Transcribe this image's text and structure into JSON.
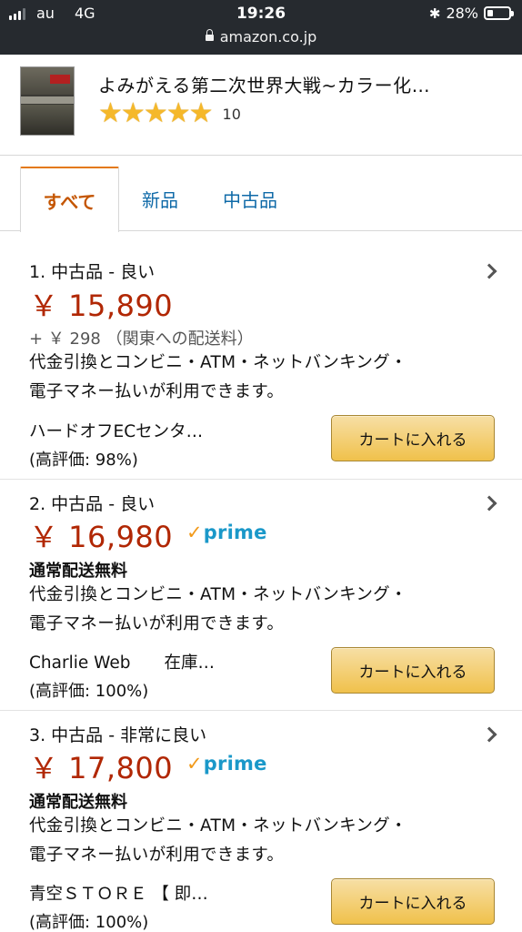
{
  "status_bar": {
    "carrier": "au",
    "network": "4G",
    "time": "19:26",
    "battery_percent": "28%",
    "battery_level": 0.28,
    "url": "amazon.co.jp"
  },
  "product": {
    "title": "よみがえる第二次世界大戦~カラー化…",
    "rating_stars": 5,
    "rating_count": "10"
  },
  "tabs": [
    {
      "label": "すべて",
      "selected": true
    },
    {
      "label": "新品",
      "selected": false
    },
    {
      "label": "中古品",
      "selected": false
    }
  ],
  "offers": [
    {
      "condition": "1. 中古品 - 良い",
      "price": "￥ 15,890",
      "prime": false,
      "shipping": "+ ￥ 298 （関東への配送料）",
      "payment_line1": "代金引換とコンビニ・ATM・ネットバンキング・",
      "payment_line2": "電子マネー払いが利用できます。",
      "seller": "ハードオフECセンタ…",
      "seller_rating": "(高評価: 98%)",
      "cart_button": "カートに入れる"
    },
    {
      "condition": "2. 中古品 - 良い",
      "price": "￥ 16,980",
      "prime": true,
      "prime_label": "prime",
      "shipping": "通常配送無料",
      "payment_line1": "代金引換とコンビニ・ATM・ネットバンキング・",
      "payment_line2": "電子マネー払いが利用できます。",
      "seller": "Charlie Web　　在庫…",
      "seller_rating": "(高評価: 100%)",
      "cart_button": "カートに入れる"
    },
    {
      "condition": "3. 中古品 - 非常に良い",
      "price": "￥ 17,800",
      "prime": true,
      "prime_label": "prime",
      "shipping": "通常配送無料",
      "payment_line1": "代金引換とコンビニ・ATM・ネットバンキング・",
      "payment_line2": "電子マネー払いが利用できます。",
      "seller": "青空ＳＴＯＲＥ 【 即…",
      "seller_rating": "(高評価: 100%)",
      "cart_button": "カートに入れる"
    }
  ],
  "colors": {
    "price": "#b12704",
    "tab_selected": "#c45500",
    "link": "#0f6aa8",
    "star": "#f5b82a",
    "prime": "#1a98c9",
    "prime_check": "#f29a1a",
    "cart_button": "#f0c14b"
  },
  "icons": {
    "signal": "cellular-signal-icon",
    "bluetooth": "bluetooth-icon",
    "battery": "battery-icon",
    "lock": "lock-icon",
    "chevron": "chevron-right-icon",
    "star": "star-icon"
  }
}
